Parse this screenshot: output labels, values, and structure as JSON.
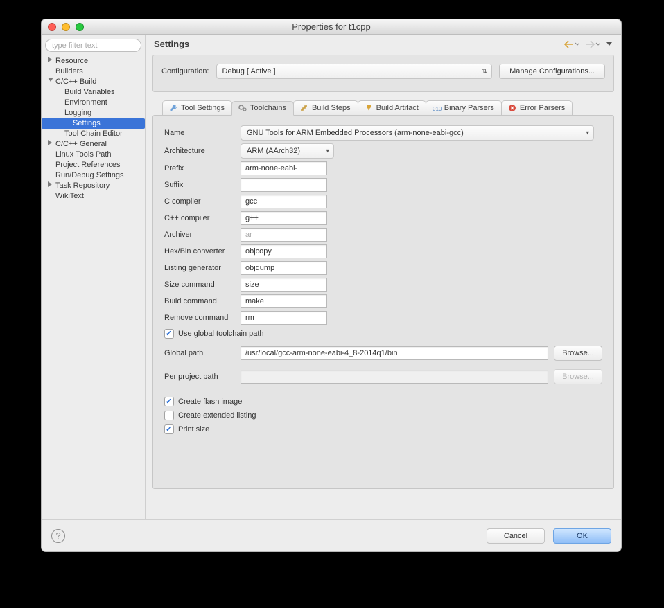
{
  "window": {
    "title": "Properties for t1cpp"
  },
  "filter": {
    "placeholder": "type filter text"
  },
  "tree": [
    {
      "label": "Resource",
      "level": 0,
      "disc": "right"
    },
    {
      "label": "Builders",
      "level": 0,
      "disc": ""
    },
    {
      "label": "C/C++ Build",
      "level": 0,
      "disc": "down"
    },
    {
      "label": "Build Variables",
      "level": 1,
      "disc": ""
    },
    {
      "label": "Environment",
      "level": 1,
      "disc": ""
    },
    {
      "label": "Logging",
      "level": 1,
      "disc": ""
    },
    {
      "label": "Settings",
      "level": 1,
      "disc": "",
      "selected": true
    },
    {
      "label": "Tool Chain Editor",
      "level": 1,
      "disc": ""
    },
    {
      "label": "C/C++ General",
      "level": 0,
      "disc": "right"
    },
    {
      "label": "Linux Tools Path",
      "level": 0,
      "disc": ""
    },
    {
      "label": "Project References",
      "level": 0,
      "disc": ""
    },
    {
      "label": "Run/Debug Settings",
      "level": 0,
      "disc": ""
    },
    {
      "label": "Task Repository",
      "level": 0,
      "disc": "right"
    },
    {
      "label": "WikiText",
      "level": 0,
      "disc": ""
    }
  ],
  "heading": "Settings",
  "config": {
    "label": "Configuration:",
    "value": "Debug  [ Active ]",
    "manage": "Manage Configurations..."
  },
  "tabs": {
    "tool_settings": "Tool Settings",
    "toolchains": "Toolchains",
    "build_steps": "Build Steps",
    "build_artifact": "Build Artifact",
    "binary_parsers": "Binary Parsers",
    "error_parsers": "Error Parsers"
  },
  "form": {
    "name_label": "Name",
    "name_value": "GNU Tools for ARM Embedded Processors (arm-none-eabi-gcc)",
    "arch_label": "Architecture",
    "arch_value": "ARM (AArch32)",
    "prefix_label": "Prefix",
    "prefix_value": "arm-none-eabi-",
    "suffix_label": "Suffix",
    "suffix_value": "",
    "ccomp_label": "C compiler",
    "ccomp_value": "gcc",
    "cpp_label": "C++ compiler",
    "cpp_value": "g++",
    "arch_iver_label": "Archiver",
    "arch_iver_value": "ar",
    "hex_label": "Hex/Bin converter",
    "hex_value": "objcopy",
    "list_label": "Listing generator",
    "list_value": "objdump",
    "size_label": "Size command",
    "size_value": "size",
    "build_label": "Build command",
    "build_value": "make",
    "rm_label": "Remove command",
    "rm_value": "rm",
    "use_global": "Use global toolchain path",
    "global_label": "Global path",
    "global_value": "/usr/local/gcc-arm-none-eabi-4_8-2014q1/bin",
    "browse": "Browse...",
    "perproj_label": "Per project path",
    "perproj_value": "",
    "create_flash": "Create flash image",
    "create_listing": "Create extended listing",
    "print_size": "Print size"
  },
  "footer": {
    "cancel": "Cancel",
    "ok": "OK"
  }
}
